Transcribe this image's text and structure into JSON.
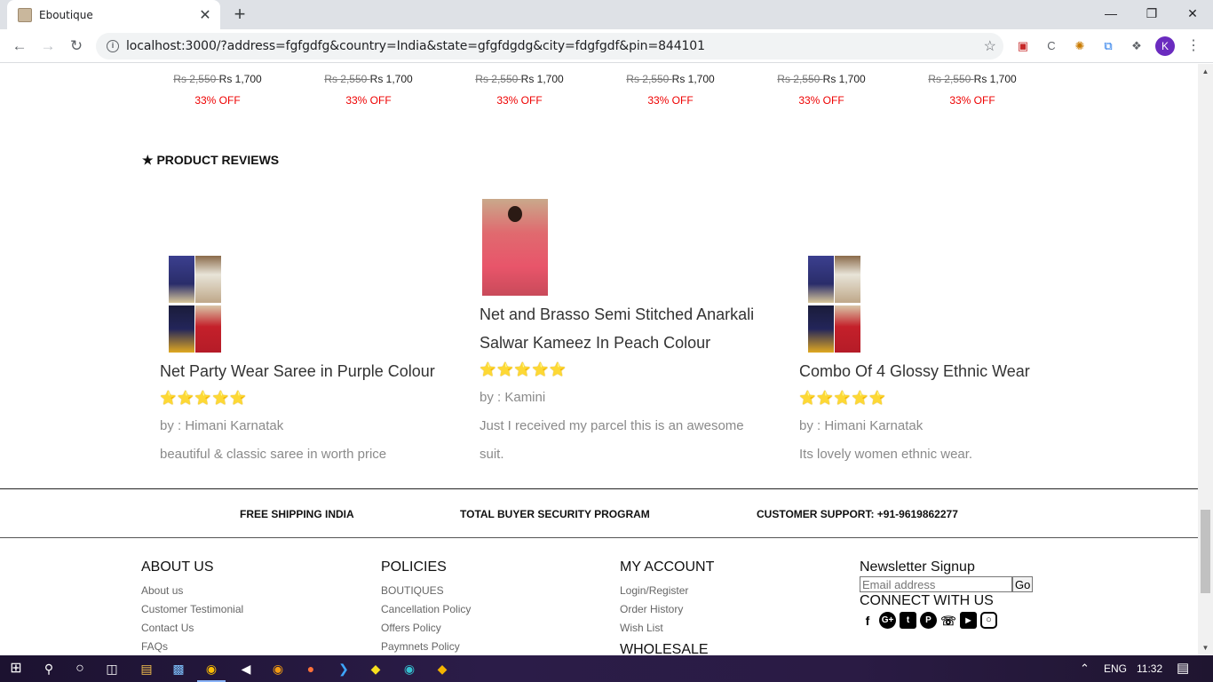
{
  "browser": {
    "tab_title": "Eboutique",
    "tab_close": "✕",
    "new_tab": "+",
    "url": "localhost:3000/?address=fgfgdfg&country=India&state=gfgfdgdg&city=fdgfgdf&pin=844101",
    "profile_initial": "K"
  },
  "price_row": [
    {
      "old": "Rs 2,550 ",
      "new": "Rs 1,700",
      "off": "33% OFF"
    },
    {
      "old": "Rs 2,550 ",
      "new": "Rs 1,700",
      "off": "33% OFF"
    },
    {
      "old": "Rs 2,550 ",
      "new": "Rs 1,700",
      "off": "33% OFF"
    },
    {
      "old": "Rs 2,550 ",
      "new": "Rs 1,700",
      "off": "33% OFF"
    },
    {
      "old": "Rs 2,550 ",
      "new": "Rs 1,700",
      "off": "33% OFF"
    },
    {
      "old": "Rs 2,550 ",
      "new": "Rs 1,700",
      "off": "33% OFF"
    }
  ],
  "reviews_section": {
    "title": "★ PRODUCT REVIEWS",
    "items": [
      {
        "product": "Net Party Wear Saree in Purple Colour",
        "stars": "⭐⭐⭐⭐⭐",
        "by": "by : Himani Karnatak",
        "text": "beautiful & classic saree in worth price"
      },
      {
        "product": "Net and Brasso Semi Stitched Anarkali Salwar Kameez In Peach Colour",
        "stars": "⭐⭐⭐⭐⭐",
        "by": "by : Kamini",
        "text": "Just I received my parcel this is an awesome suit."
      },
      {
        "product": "Combo Of 4 Glossy Ethnic Wear",
        "stars": "⭐⭐⭐⭐⭐",
        "by": "by : Himani Karnatak",
        "text": "Its lovely women ethnic wear."
      }
    ]
  },
  "features": {
    "shipping": "FREE SHIPPING INDIA",
    "security": "TOTAL BUYER SECURITY PROGRAM",
    "support": "CUSTOMER SUPPORT: +91-9619862277"
  },
  "footer": {
    "about": {
      "title": "ABOUT US",
      "links": [
        "About us",
        "Customer Testimonial",
        "Contact Us",
        "FAQs"
      ]
    },
    "policies": {
      "title": "POLICIES",
      "links": [
        "BOUTIQUES",
        "Cancellation Policy",
        "Offers Policy",
        "Paymnets Policy"
      ]
    },
    "account": {
      "title": "MY ACCOUNT",
      "links": [
        "Login/Register",
        "Order History",
        "Wish List"
      ],
      "wholesale": "WHOLESALE"
    },
    "newsletter": {
      "title": "Newsletter Signup",
      "placeholder": "Email address",
      "go": "Go",
      "connect": "CONNECT WITH US"
    }
  },
  "taskbar": {
    "lang": "ENG",
    "time": "11:32"
  }
}
